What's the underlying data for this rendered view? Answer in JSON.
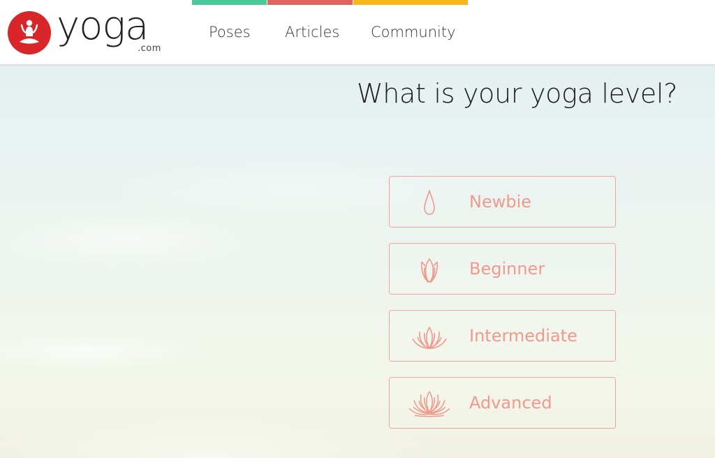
{
  "brand": {
    "logo_word": "yoga",
    "logo_suffix": ".com",
    "logo_color": "#d9262a"
  },
  "nav": {
    "items": [
      {
        "label": "Poses",
        "accent": "#4cc99a"
      },
      {
        "label": "Articles",
        "accent": "#e0635f"
      },
      {
        "label": "Community",
        "accent": "#f7b71c"
      }
    ]
  },
  "main": {
    "heading": "What is your yoga level?",
    "accent_color": "#f0998c",
    "levels": [
      {
        "label": "Newbie",
        "icon": "drop-icon"
      },
      {
        "label": "Beginner",
        "icon": "tulip-bud-icon"
      },
      {
        "label": "Intermediate",
        "icon": "lotus-icon"
      },
      {
        "label": "Advanced",
        "icon": "full-lotus-icon"
      }
    ]
  }
}
